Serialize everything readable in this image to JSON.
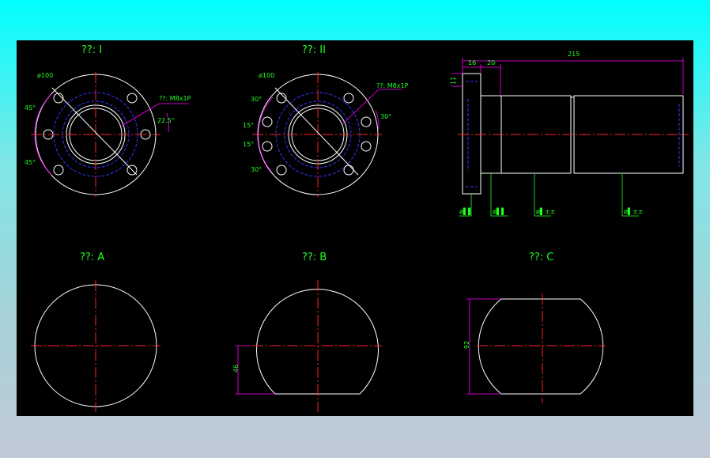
{
  "views": {
    "view1": {
      "title": "??: I",
      "dia_label": "ø100",
      "thread_label": "??: M8x1P",
      "angle_a": "45°",
      "angle_b": "45°",
      "angle_c": "22.5°"
    },
    "view2": {
      "title": "??: II",
      "dia_label": "ø100",
      "thread_label": "??: M8x1P",
      "angle_a": "30°",
      "angle_b": "15°",
      "angle_c": "15°",
      "angle_d": "30°",
      "angle_e": "30°"
    },
    "side": {
      "dim_total": "215",
      "dim_a": "16",
      "dim_b": "20",
      "dim_c": "11",
      "lead1": "ø▌▌",
      "lead2": "ø▌▌",
      "lead3": "ø▌±±",
      "lead4": "ø▌±±"
    },
    "viewA": {
      "title": "??: A"
    },
    "viewB": {
      "title": "??: B",
      "dim": "46"
    },
    "viewC": {
      "title": "??: C",
      "dim": "92"
    }
  },
  "colors": {
    "outline": "#ffffff",
    "center": "#ff2222",
    "hidden": "#3333ff",
    "dimension": "#ff00ff",
    "text": "#22ff22",
    "canvas": "#000000"
  }
}
